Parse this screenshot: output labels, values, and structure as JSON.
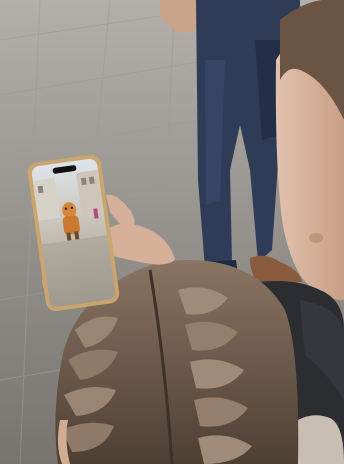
{
  "photo": {
    "subject": "child-viewing-ar-character-on-smartphone",
    "colors": {
      "pavement_light": "#b3b0ab",
      "pavement_dark": "#77736e",
      "jeans": "#2e3c58",
      "jeans_dark": "#1d2740",
      "skin": "#d8b39b",
      "hair": "#6f5a49",
      "hair_light": "#9a8573",
      "jacket": "#2b2d31",
      "phone_frame": "#c9a56f",
      "ar_character": "#d8873a"
    }
  },
  "phone_screen": {
    "status_badge": "",
    "scene": "street-with-animated-character"
  }
}
